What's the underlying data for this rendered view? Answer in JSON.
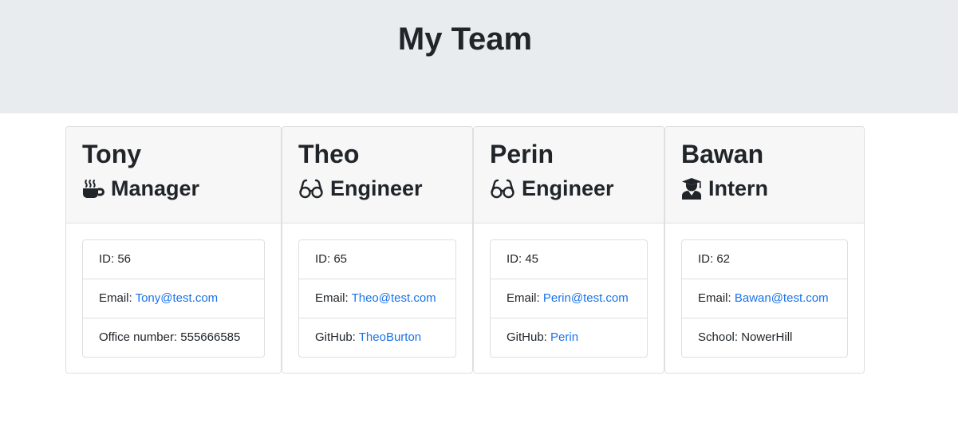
{
  "header": {
    "title": "My Team"
  },
  "team": [
    {
      "name": "Tony",
      "role": "Manager",
      "icon": "coffee-icon",
      "id_label": "ID: ",
      "id": "56",
      "email_label": "Email: ",
      "email": "Tony@test.com",
      "extra_label": "Office number: ",
      "extra_value": "555666585"
    },
    {
      "name": "Theo",
      "role": "Engineer",
      "icon": "glasses-icon",
      "id_label": "ID: ",
      "id": "65",
      "email_label": "Email: ",
      "email": "Theo@test.com",
      "extra_label": "GitHub: ",
      "extra_value": "TheoBurton"
    },
    {
      "name": "Perin",
      "role": "Engineer",
      "icon": "glasses-icon",
      "id_label": "ID: ",
      "id": "45",
      "email_label": "Email: ",
      "email": "Perin@test.com",
      "extra_label": "GitHub: ",
      "extra_value": "Perin"
    },
    {
      "name": "Bawan",
      "role": "Intern",
      "icon": "graduate-icon",
      "id_label": "ID: ",
      "id": "62",
      "email_label": "Email: ",
      "email": "Bawan@test.com",
      "extra_label": "School: ",
      "extra_value": "NowerHill"
    }
  ],
  "colors": {
    "jumbotron_bg": "#e9ecef",
    "card_header_bg": "#f7f7f7",
    "link": "#1a73e8",
    "text": "#212529"
  }
}
